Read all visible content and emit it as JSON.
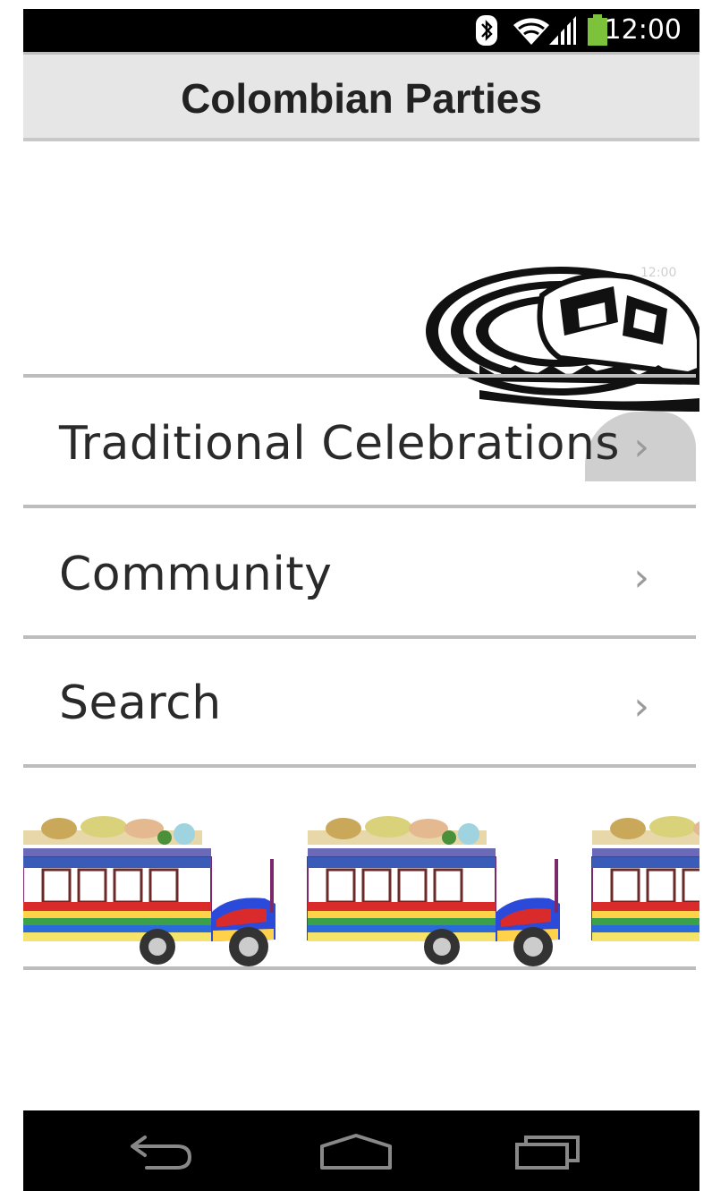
{
  "status_bar": {
    "time": "12:00",
    "icons": [
      "bluetooth-icon",
      "wifi-icon",
      "cell-signal-icon",
      "battery-icon"
    ],
    "battery_color": "#7cc23a"
  },
  "header": {
    "title": "Colombian Parties"
  },
  "overlay_time": "12:00",
  "menu": {
    "items": [
      {
        "label": "Traditional Celebrations",
        "chevron": "›"
      },
      {
        "label": "Community",
        "chevron": "›"
      },
      {
        "label": "Search",
        "chevron": "›"
      }
    ]
  },
  "images": {
    "hat": "sombrero-vueltiao-image",
    "buses": "chiva-bus-strip-image"
  },
  "nav_bar": {
    "icons": [
      "back-icon",
      "home-icon",
      "recent-apps-icon"
    ]
  }
}
